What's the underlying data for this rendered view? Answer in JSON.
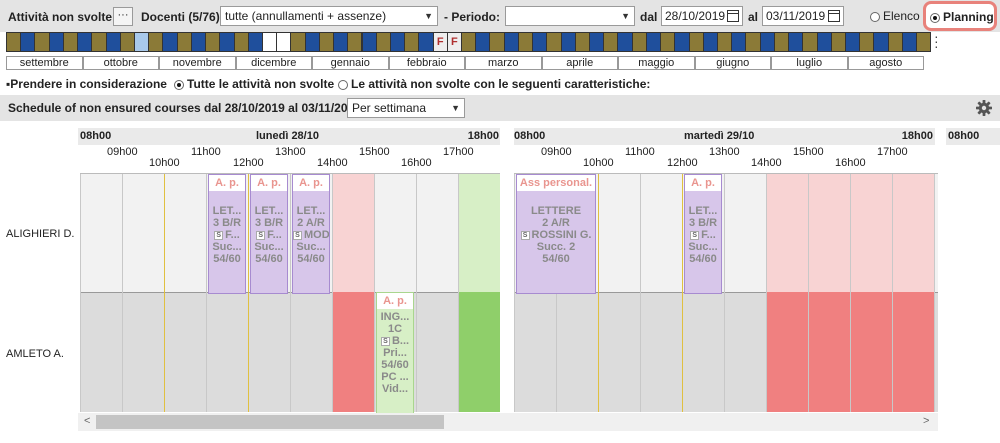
{
  "toolbar": {
    "title": "Attività non svolte",
    "more_btn": "···",
    "docenti_label": "Docenti (5/76)",
    "filter_value": "tutte (annullamenti + assenze)",
    "periodo_label": "Periodo:",
    "periodo_value": "",
    "dal_label": "dal",
    "date_from": "28/10/2019",
    "al_label": "al",
    "date_to": "03/11/2019",
    "view_elenco": "Elenco",
    "view_planning": "Planning"
  },
  "strip": {
    "marker": "F",
    "months": [
      "settembre",
      "ottobre",
      "novembre",
      "dicembre",
      "gennaio",
      "febbraio",
      "marzo",
      "aprile",
      "maggio",
      "giugno",
      "luglio",
      "agosto"
    ]
  },
  "consider": {
    "label": "Prendere in considerazione",
    "opt_all": "Tutte le attività non svolte",
    "opt_filtered": "Le attività non svolte con le seguenti caratteristiche:"
  },
  "schedule": {
    "title": "Schedule of non ensured courses dal 28/10/2019 al 03/11/2019",
    "grouping": "Per settimana"
  },
  "days": [
    {
      "label": "lunedì 28/10",
      "start": "08h00",
      "end": "18h00"
    },
    {
      "label": "martedì 29/10",
      "start": "08h00",
      "end": "18h00"
    },
    {
      "label": "",
      "start": "08h00",
      "end": ""
    }
  ],
  "hours_mon": [
    "09h00",
    "10h00",
    "11h00",
    "12h00",
    "13h00",
    "14h00",
    "15h00",
    "16h00",
    "17h00"
  ],
  "hours_tue": [
    "09h00",
    "10h00",
    "11h00",
    "12h00",
    "13h00",
    "14h00",
    "15h00",
    "16h00",
    "17h00"
  ],
  "teachers": [
    "ALIGHIERI D.",
    "AMLETO A."
  ],
  "courses": [
    {
      "head": "A. p.",
      "lines": [
        "LET...",
        "3 B/R",
        "F...",
        "Suc...",
        "54/60"
      ]
    },
    {
      "head": "A. p.",
      "lines": [
        "LET...",
        "3 B/R",
        "F...",
        "Suc...",
        "54/60"
      ]
    },
    {
      "head": "A. p.",
      "lines": [
        "LET...",
        "2 A/R",
        "MOD",
        "Suc...",
        "54/60"
      ]
    },
    {
      "head": "Ass personal.",
      "lines": [
        "LETTERE",
        "2 A/R",
        "ROSSINI G.",
        "Succ. 2",
        "54/60"
      ]
    },
    {
      "head": "A. p.",
      "lines": [
        "LET...",
        "3 B/R",
        "F...",
        "Suc...",
        "54/60"
      ]
    },
    {
      "head": "A. p.",
      "lines": [
        "ING...",
        "1C",
        "B...",
        "Pri...",
        "54/60",
        "PC ...",
        "Vid..."
      ]
    }
  ],
  "colors": {
    "strip_blue": "#1f4f9c",
    "strip_olive": "#8b7a37",
    "highlight": "#e8827b",
    "pink_light": "#f8d3d3",
    "pink_strong": "#f08080",
    "green_light": "#d7efc6",
    "green_strong": "#8fcf6a",
    "purple": "#d7c6ea"
  }
}
